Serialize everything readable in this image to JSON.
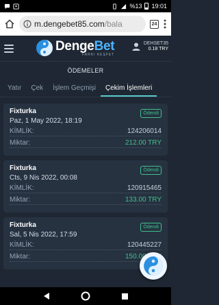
{
  "status_bar": {
    "battery": "%13",
    "time": "19:01"
  },
  "browser": {
    "url_host": "m.dengebet85.com",
    "url_path": "/bala",
    "tab_count": "24"
  },
  "header": {
    "logo_word_1": "Denge",
    "logo_word_2": "Bet",
    "logo_tagline": "FARKI KEŞFET",
    "username": "DEHSET35",
    "balance": "0.18 TRY"
  },
  "page": {
    "title": "ÖDEMELER"
  },
  "tabs": [
    {
      "label": "Yatır"
    },
    {
      "label": "Çek"
    },
    {
      "label": "İşlem Geçmişi"
    },
    {
      "label": "Çekim İşlemleri"
    }
  ],
  "labels": {
    "id": "KİMLİK:",
    "amount": "Miktar:"
  },
  "transactions": [
    {
      "method": "Fixturka",
      "date": "Paz, 1 May 2022, 18:19",
      "status": "Ödendi",
      "id": "124206014",
      "amount": "212.00 TRY"
    },
    {
      "method": "Fixturka",
      "date": "Cts, 9 Nis 2022, 00:08",
      "status": "Ödendi",
      "id": "120915465",
      "amount": "133.00 TRY"
    },
    {
      "method": "Fixturka",
      "date": "Sal, 5 Nis 2022, 17:59",
      "status": "Ödendi",
      "id": "120445227",
      "amount": "150.00 TRY"
    }
  ],
  "colors": {
    "background": "#1e2733",
    "card": "#273241",
    "accent": "#5ac8c8",
    "paid": "#3fc28a"
  }
}
